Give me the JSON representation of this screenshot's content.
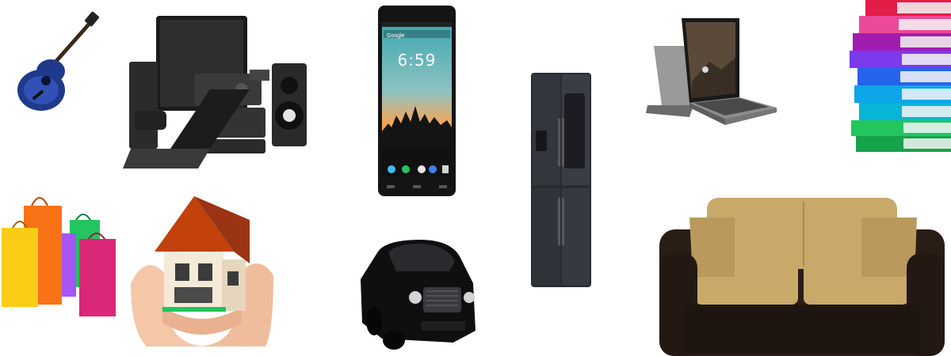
{
  "banner": {
    "items": [
      {
        "id": "guitar",
        "label": "guitar"
      },
      {
        "id": "electronics",
        "label": "electronics"
      },
      {
        "id": "smartphone",
        "label": "smartphone"
      },
      {
        "id": "refrigerator",
        "label": "refrigerator"
      },
      {
        "id": "laptop",
        "label": "laptop"
      },
      {
        "id": "books",
        "label": "books"
      },
      {
        "id": "shopping-bags",
        "label": "shopping-bags"
      },
      {
        "id": "house",
        "label": "house"
      },
      {
        "id": "car",
        "label": "car"
      },
      {
        "id": "sofa",
        "label": "sofa"
      }
    ],
    "phone_screen": {
      "time": "6:59",
      "search": "Google"
    },
    "colors": {
      "guitar_blue": "#1f3a8a",
      "book_colors": [
        "#e11d48",
        "#ec4899",
        "#a21caf",
        "#7c3aed",
        "#2563eb",
        "#0ea5e9",
        "#06b6d4",
        "#22c55e",
        "#16a34a"
      ],
      "bag_colors": [
        "#facc15",
        "#f97316",
        "#ef4444",
        "#22c55e",
        "#db2777",
        "#a855f7"
      ],
      "sofa_frame": "#2a1d15",
      "sofa_cushion": "#c9a96a",
      "house_roof": "#c2410c"
    }
  }
}
